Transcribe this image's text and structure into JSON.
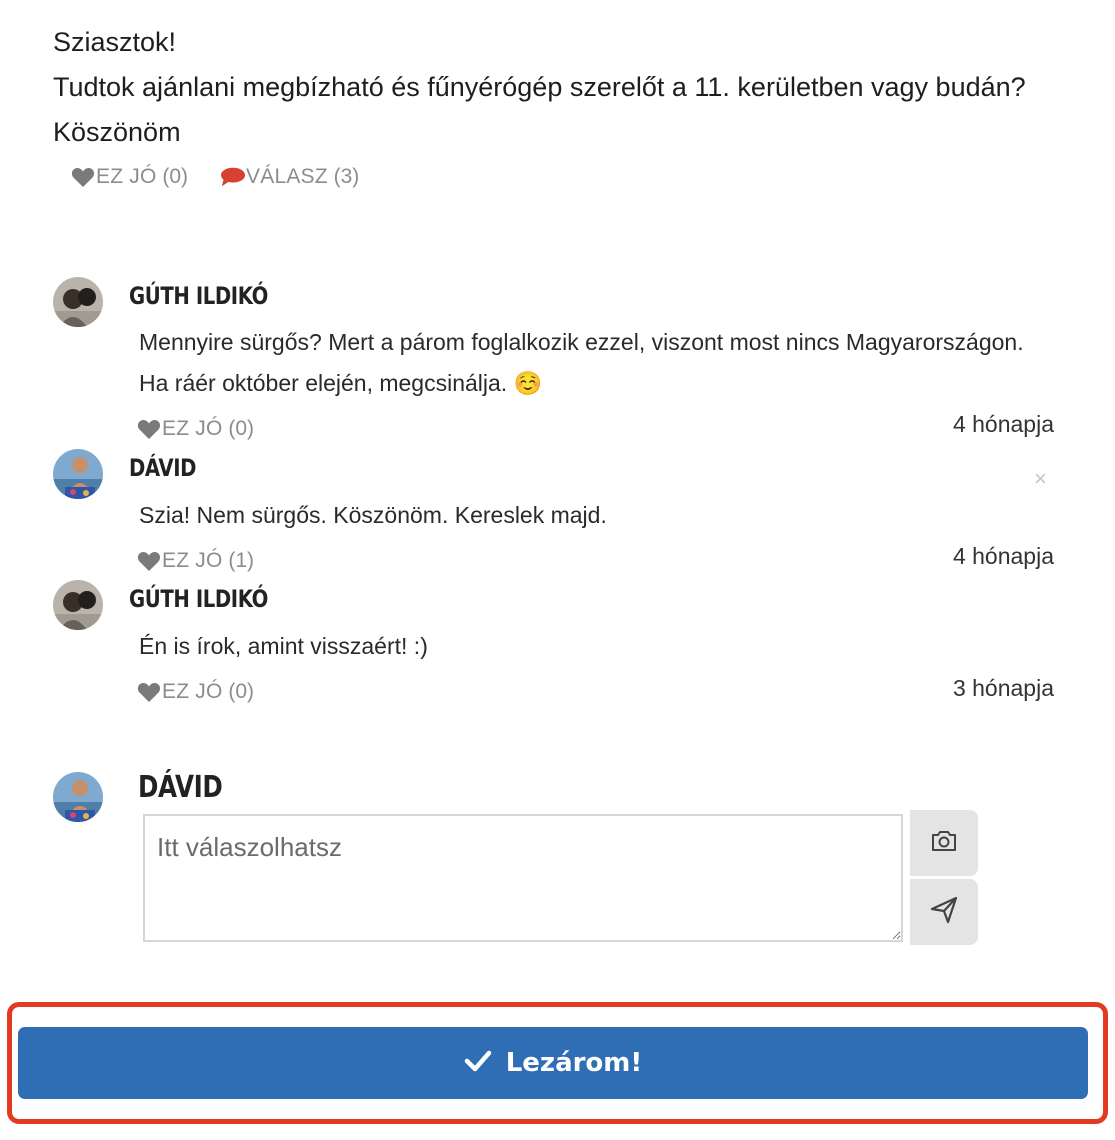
{
  "post": {
    "lines": [
      "Sziasztok!",
      "Tudtok ajánlani megbízható és fűnyérógép szerelőt a 11. kerületben vagy budán?",
      "Köszönöm"
    ],
    "like_label": "EZ JÓ",
    "like_count": "(0)",
    "reply_label": "VÁLASZ",
    "reply_count": "(3)"
  },
  "comments": [
    {
      "author": "GÚTH ILDIKÓ",
      "lines": [
        "Mennyire sürgős? Mert a párom foglalkozik ezzel, viszont most nincs Magyarországon.",
        "Ha ráér október elején, megcsinálja. ☺️"
      ],
      "like_label": "EZ JÓ",
      "like_count": "(0)",
      "time": "4 hónapja"
    },
    {
      "author": "DÁVID",
      "lines": [
        "Szia! Nem sürgős. Köszönöm. Kereslek majd."
      ],
      "like_label": "EZ JÓ",
      "like_count": "(1)",
      "time": "4 hónapja",
      "close": "×"
    },
    {
      "author": "GÚTH ILDIKÓ",
      "lines": [
        "Én is írok, amint visszaért! :)"
      ],
      "like_label": "EZ JÓ",
      "like_count": "(0)",
      "time": "3 hónapja"
    }
  ],
  "reply": {
    "author": "DÁVID",
    "placeholder": "Itt válaszolhatsz"
  },
  "close_button": {
    "label": "Lezárom!"
  },
  "icons": {
    "like": "heart-icon",
    "reply": "speech-bubble-icon",
    "photo": "camera-icon",
    "send": "paper-plane-icon",
    "close": "close-icon",
    "confirm": "checkmark-icon"
  },
  "colors": {
    "primary": "#2f6eb5",
    "highlight": "#e23a23",
    "reply_icon": "#d64132",
    "like_icon": "#7a7a7a"
  }
}
